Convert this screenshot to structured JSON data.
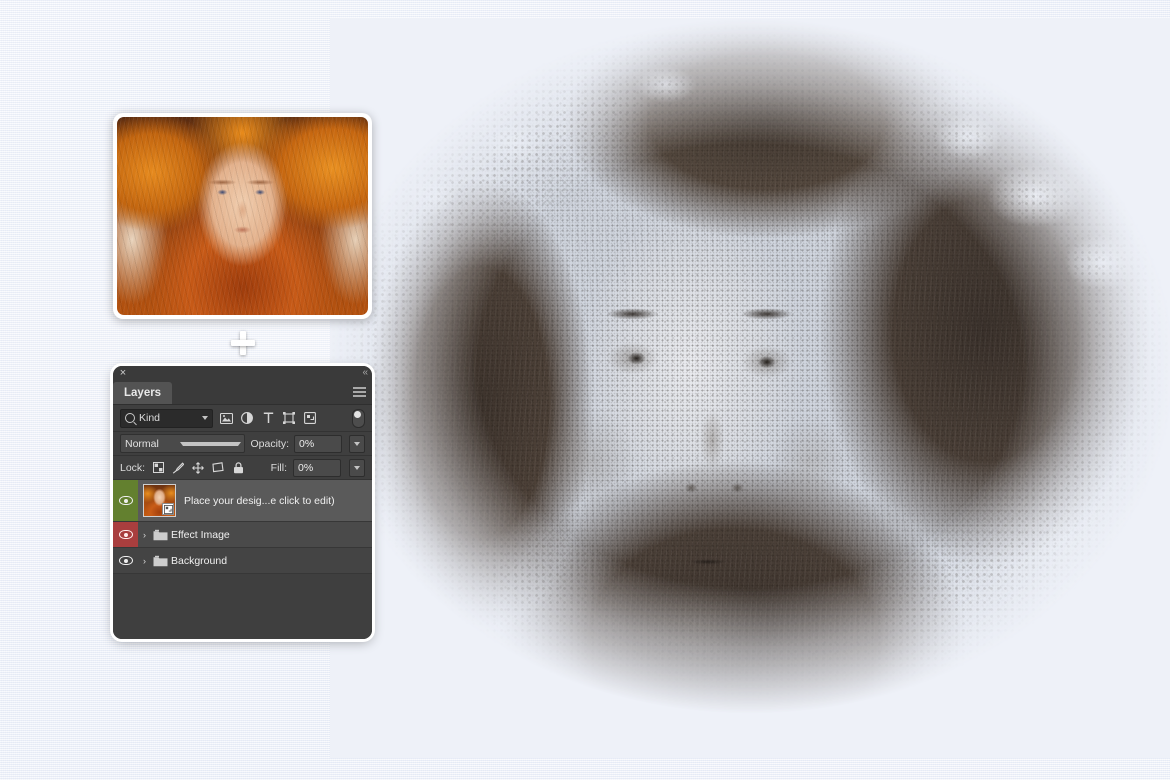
{
  "canvas": {
    "background_color": "#eef1f8",
    "artwork_title": "charcoal-sketch-portrait",
    "artwork_description": "Monochrome charcoal sketch effect portrait of a woman with autumn leaves, stippled spray edges fading into paper",
    "plus_symbol": "+"
  },
  "source_photo": {
    "name": "source-photo-thumbnail",
    "description": "Color photo of a red-haired woman wearing a crown of orange autumn leaves"
  },
  "panel": {
    "title": "Layers",
    "close_label": "×",
    "collapse_label": "«",
    "menu_label": "menu",
    "filter": {
      "kind_label": "Kind",
      "icons": [
        {
          "name": "filter-pixel-icon",
          "title": "Filter for pixel layers"
        },
        {
          "name": "filter-adjustment-icon",
          "title": "Filter for adjustment layers"
        },
        {
          "name": "filter-type-icon",
          "title": "Filter for type layers",
          "glyph": "T"
        },
        {
          "name": "filter-shape-icon",
          "title": "Filter for shape layers"
        },
        {
          "name": "filter-smart-object-icon",
          "title": "Filter for smart objects"
        }
      ],
      "toggle_name": "filter-toggle-switch"
    },
    "blend": {
      "mode": "Normal",
      "opacity_label": "Opacity:",
      "opacity_value": "0%"
    },
    "lock": {
      "label": "Lock:",
      "icons": [
        {
          "name": "lock-transparency-icon",
          "title": "Lock transparent pixels"
        },
        {
          "name": "lock-paint-icon",
          "title": "Lock image pixels"
        },
        {
          "name": "lock-position-icon",
          "title": "Lock position"
        },
        {
          "name": "lock-artboard-icon",
          "title": "Prevent auto-nesting"
        },
        {
          "name": "lock-all-icon",
          "title": "Lock all"
        }
      ],
      "fill_label": "Fill:",
      "fill_value": "0%"
    },
    "layers": [
      {
        "name": "Place your desig...e click to edit)",
        "type": "smart-object",
        "visible": true,
        "selected": true,
        "color_label": "#63802f",
        "has_thumbnail": true,
        "expandable": false
      },
      {
        "name": "Effect Image",
        "type": "group",
        "visible": true,
        "selected": false,
        "color_label": "#a93e3e",
        "has_thumbnail": false,
        "expandable": true,
        "expand_glyph": "›"
      },
      {
        "name": "Background",
        "type": "group",
        "visible": true,
        "selected": false,
        "color_label": "none",
        "has_thumbnail": false,
        "expandable": true,
        "expand_glyph": "›"
      }
    ]
  },
  "colors": {
    "panel_bg": "#3f3f3f",
    "panel_tab_bg": "#535353",
    "row_selected": "#5a5a5a",
    "label_green": "#63802f",
    "label_red": "#a93e3e",
    "paper": "#eef1f8",
    "artwork_dark": "#3b322c"
  }
}
